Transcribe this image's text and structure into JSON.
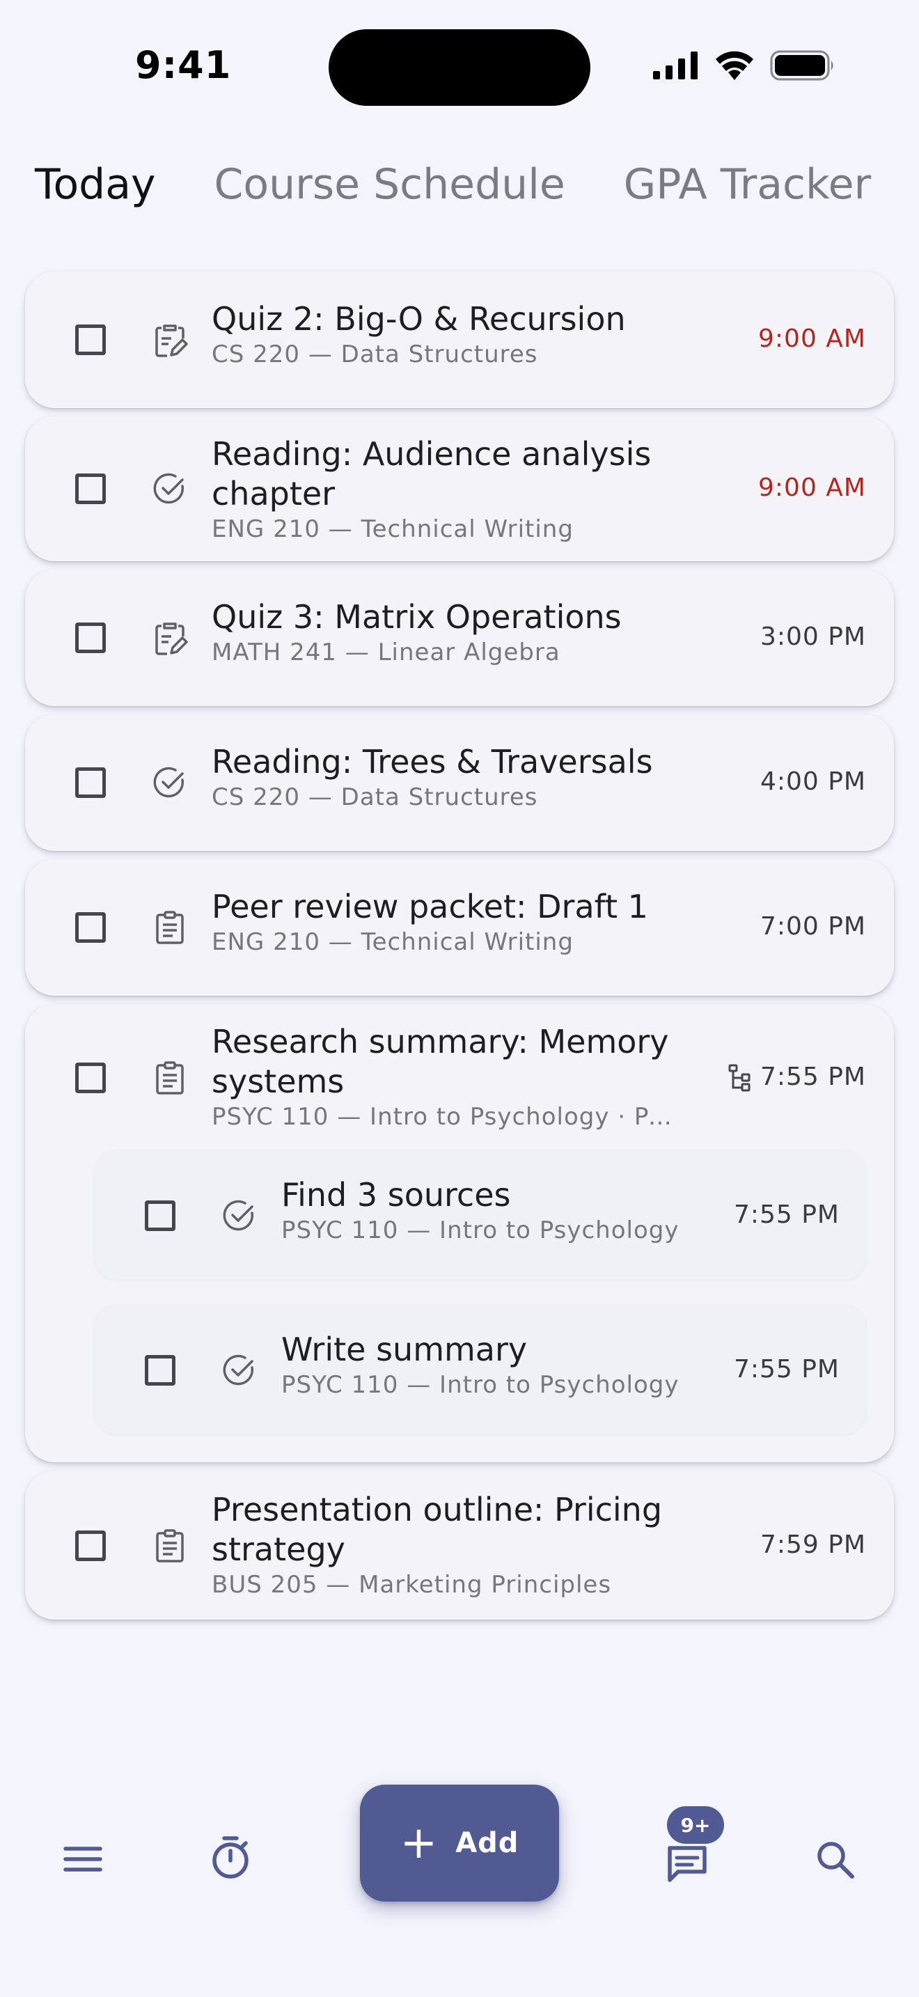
{
  "status_bar": {
    "time": "9:41"
  },
  "tabs": [
    {
      "label": "Today",
      "active": true
    },
    {
      "label": "Course Schedule",
      "active": false
    },
    {
      "label": "GPA Tracker",
      "active": false
    }
  ],
  "tasks": [
    {
      "icon": "quiz-clipboard-icon",
      "title": "Quiz 2: Big-O & Recursion",
      "subtitle": "CS 220 — Data Structures",
      "due": "9:00 AM",
      "overdue": true
    },
    {
      "icon": "check-circle-icon",
      "title": "Reading: Audience analysis chapter",
      "subtitle": "ENG 210 — Technical Writing",
      "due": "9:00 AM",
      "overdue": true
    },
    {
      "icon": "quiz-clipboard-icon",
      "title": "Quiz 3: Matrix Operations",
      "subtitle": "MATH 241 — Linear Algebra",
      "due": "3:00 PM",
      "overdue": false
    },
    {
      "icon": "check-circle-icon",
      "title": "Reading: Trees & Traversals",
      "subtitle": "CS 220 — Data Structures",
      "due": "4:00 PM",
      "overdue": false
    },
    {
      "icon": "assignment-icon",
      "title": "Peer review packet: Draft 1",
      "subtitle": "ENG 210 — Technical Writing",
      "due": "7:00 PM",
      "overdue": false
    },
    {
      "icon": "assignment-icon",
      "title": "Research summary: Memory systems",
      "subtitle": "PSYC 110 — Intro to Psychology · Pa...",
      "due": "7:55 PM",
      "overdue": false,
      "subtasks": [
        {
          "icon": "check-circle-icon",
          "title": "Find 3 sources",
          "subtitle": "PSYC 110 — Intro to Psychology",
          "due": "7:55 PM"
        },
        {
          "icon": "check-circle-icon",
          "title": "Write summary",
          "subtitle": "PSYC 110 — Intro to Psychology",
          "due": "7:55 PM"
        }
      ]
    },
    {
      "icon": "assignment-icon",
      "title": "Presentation outline: Pricing strategy",
      "subtitle": "BUS 205 — Marketing Principles",
      "due": "7:59 PM",
      "overdue": false
    }
  ],
  "bottom_nav": {
    "menu_icon": "menu-icon",
    "timer_icon": "timer-icon",
    "add_label": "Add",
    "chat_icon": "chat-icon",
    "chat_badge": "9+",
    "search_icon": "search-icon"
  },
  "colors": {
    "accent": "#515a92",
    "overdue": "#b3261e",
    "background": "#f3f4fc"
  }
}
